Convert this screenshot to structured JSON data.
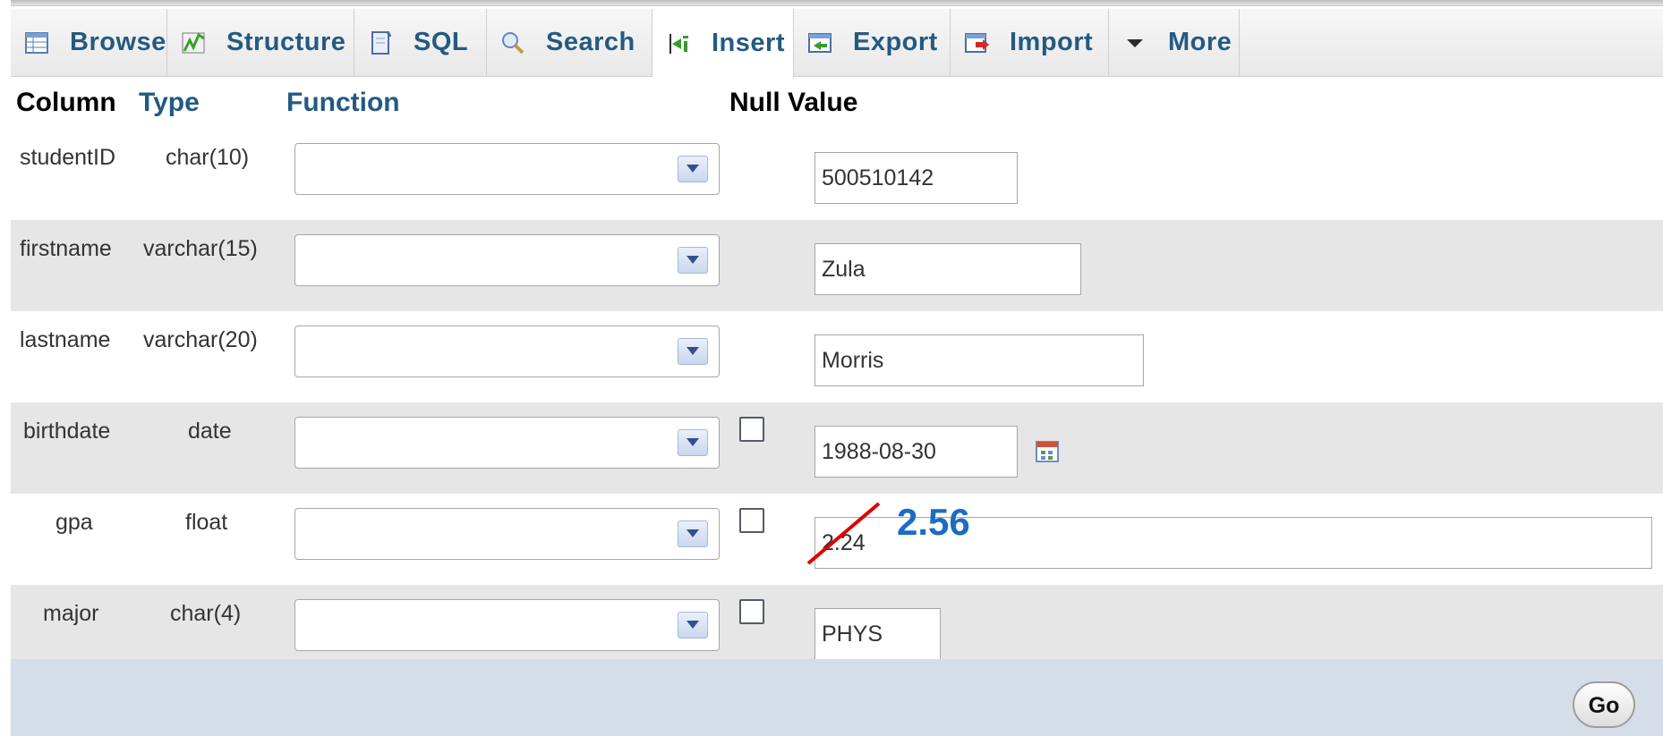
{
  "tabs": [
    {
      "label": "Browse",
      "icon": "table-icon",
      "active": false
    },
    {
      "label": "Structure",
      "icon": "structure-icon",
      "active": false
    },
    {
      "label": "SQL",
      "icon": "sql-icon",
      "active": false
    },
    {
      "label": "Search",
      "icon": "search-icon",
      "active": false
    },
    {
      "label": "Insert",
      "icon": "insert-icon",
      "active": true
    },
    {
      "label": "Export",
      "icon": "export-icon",
      "active": false
    },
    {
      "label": "Import",
      "icon": "import-icon",
      "active": false
    },
    {
      "label": "More",
      "icon": "triangle-down-icon",
      "active": false
    }
  ],
  "headers": {
    "column": "Column",
    "type": "Type",
    "function": "Function",
    "null": "Null",
    "value": "Value"
  },
  "rows": [
    {
      "column": "studentID",
      "type": "char(10)",
      "function": "",
      "null_checkbox": false,
      "value": "500510142"
    },
    {
      "column": "firstname",
      "type": "varchar(15)",
      "function": "",
      "null_checkbox": false,
      "value": "Zula"
    },
    {
      "column": "lastname",
      "type": "varchar(20)",
      "function": "",
      "null_checkbox": false,
      "value": "Morris"
    },
    {
      "column": "birthdate",
      "type": "date",
      "function": "",
      "null_checkbox": true,
      "null_checked": false,
      "value": "1988-08-30"
    },
    {
      "column": "gpa",
      "type": "float",
      "function": "",
      "null_checkbox": true,
      "null_checked": false,
      "value": "2.24"
    },
    {
      "column": "major",
      "type": "char(4)",
      "function": "",
      "null_checkbox": true,
      "null_checked": false,
      "value": "PHYS"
    }
  ],
  "annotation": {
    "text": "2.56",
    "color": "#1c6cc0",
    "strike_color": "#e00000"
  },
  "go_button": "Go",
  "colors": {
    "link": "#235a81",
    "row_alt": "#e6e6e6",
    "footer": "#d5dde8"
  }
}
